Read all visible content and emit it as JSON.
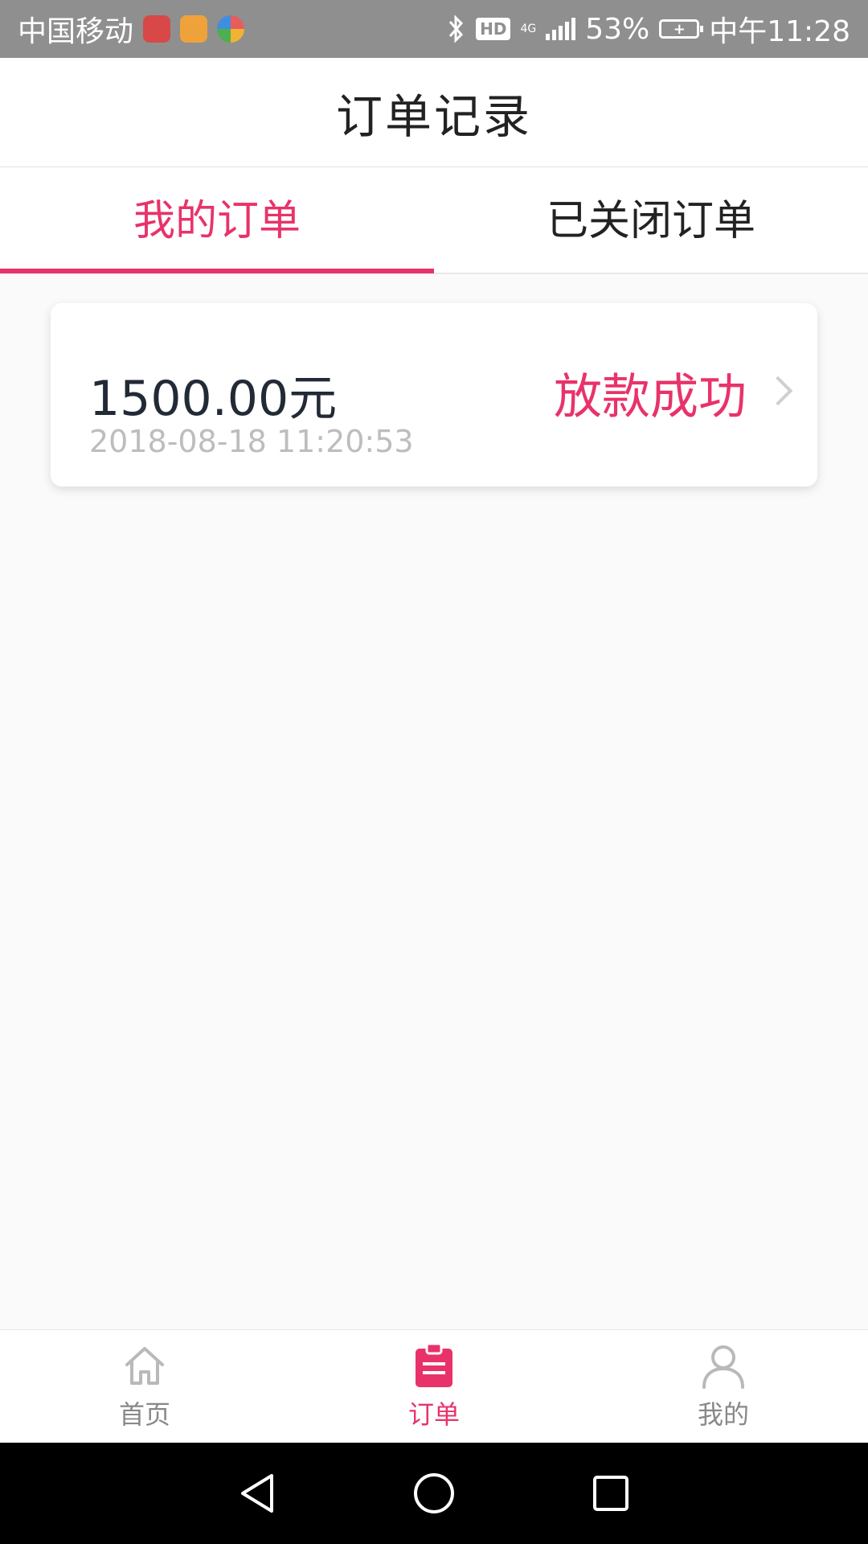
{
  "status_bar": {
    "carrier": "中国移动",
    "hd": "HD",
    "network": "4G",
    "battery_percent": "53%",
    "time": "中午11:28"
  },
  "header": {
    "title": "订单记录"
  },
  "tabs": [
    {
      "label": "我的订单",
      "active": true
    },
    {
      "label": "已关闭订单",
      "active": false
    }
  ],
  "orders": [
    {
      "amount": "1500.00元",
      "datetime": "2018-08-18 11:20:53",
      "status": "放款成功"
    }
  ],
  "bottom_nav": [
    {
      "label": "首页",
      "icon": "home-icon",
      "active": false
    },
    {
      "label": "订单",
      "icon": "clipboard-icon",
      "active": true
    },
    {
      "label": "我的",
      "icon": "user-icon",
      "active": false
    }
  ],
  "colors": {
    "accent": "#e8336a",
    "text_primary": "#222222",
    "text_muted": "#bdbdbd",
    "status_bar_bg": "#8f8f8f"
  }
}
